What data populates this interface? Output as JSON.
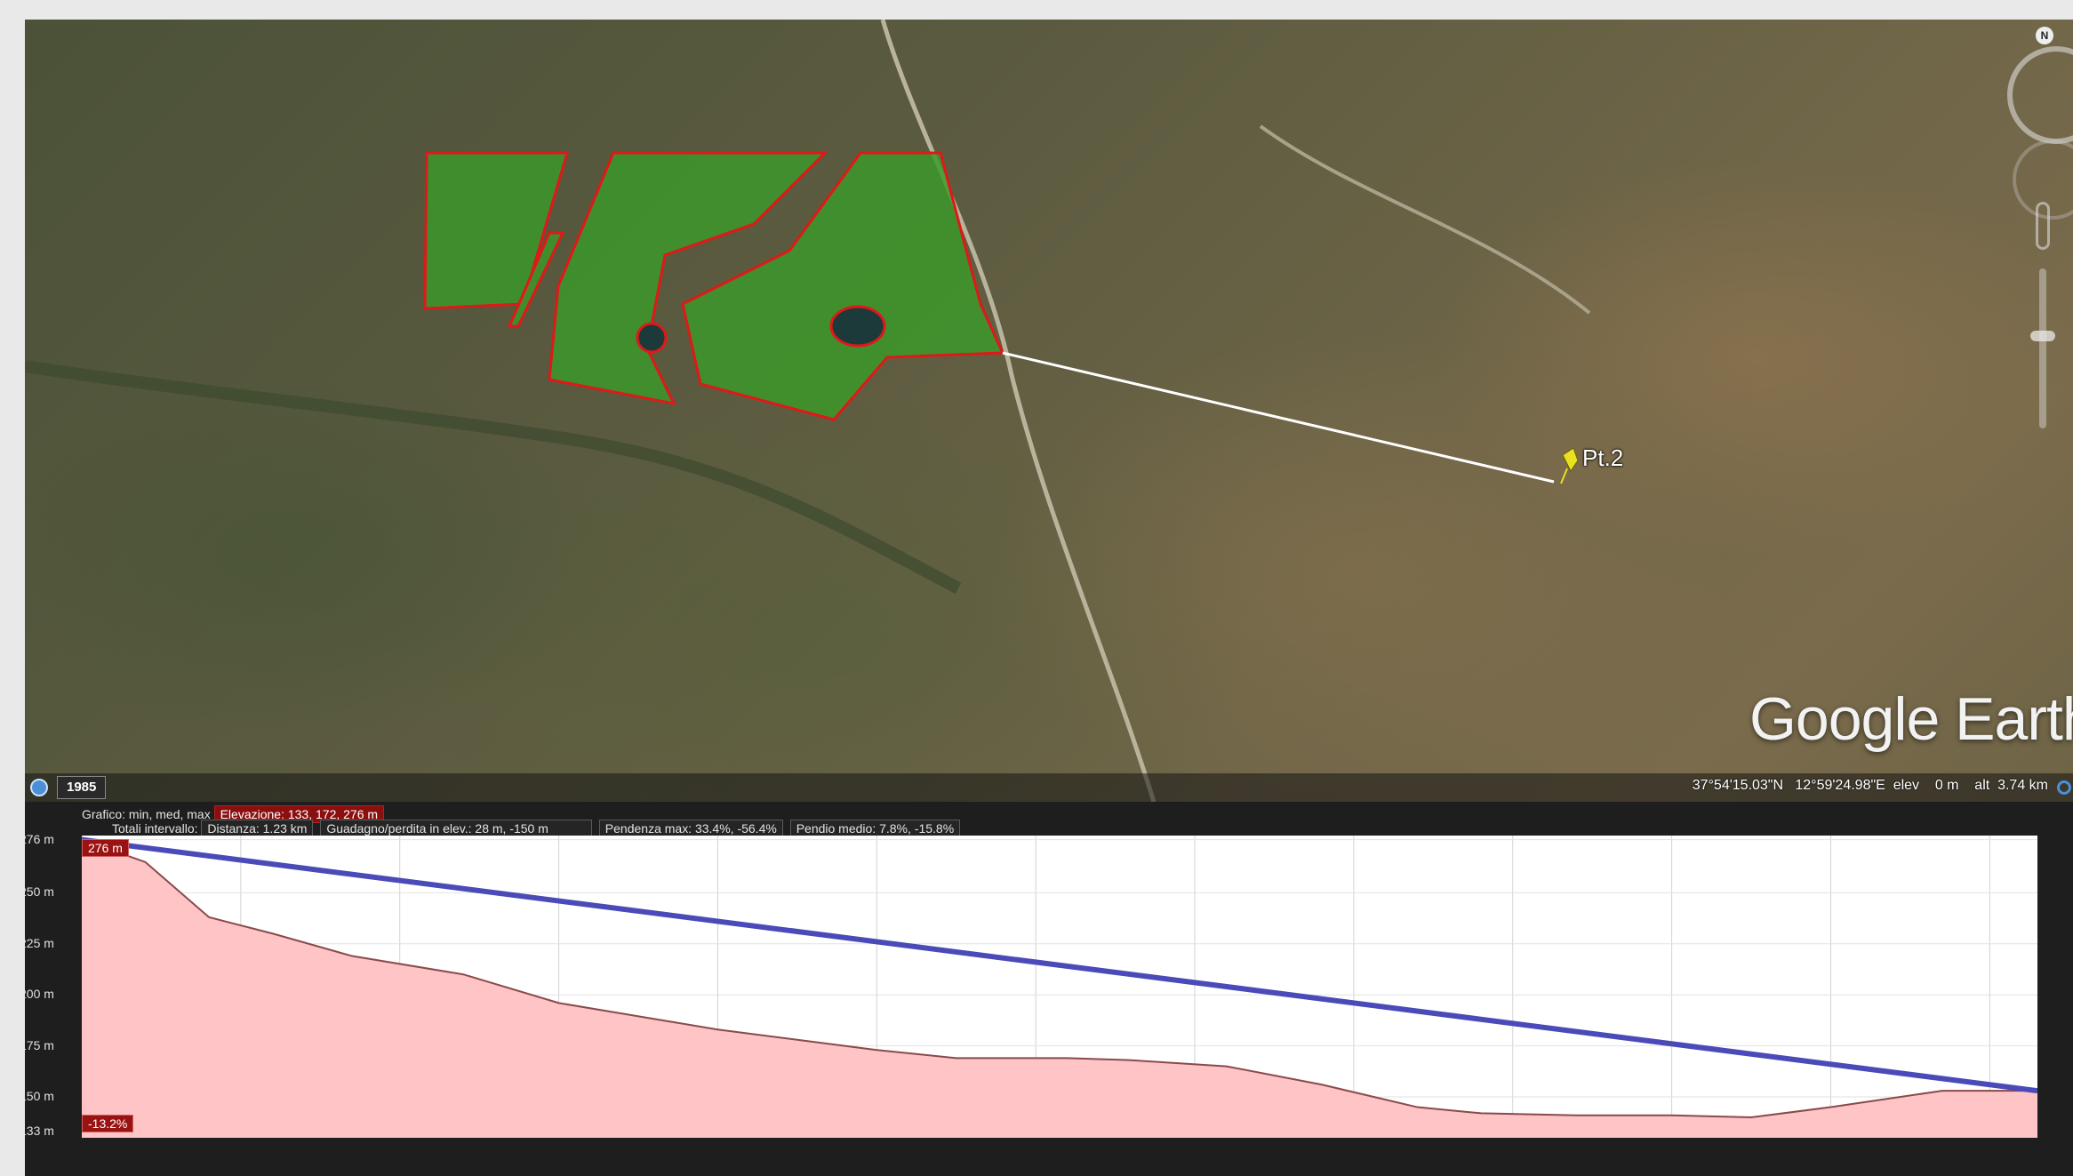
{
  "map": {
    "placemark_label": "Pt.2",
    "placemark_icon": "pushpin-icon",
    "historical_year": "1985",
    "logo_text": "Google Earth",
    "coords_text": "37°54'15.03\"N   12°59'24.98\"E  elev    0 m    alt  3.74 km",
    "north_label": "N",
    "field_color": "#3a9a2a",
    "field_border_color": "#e01818",
    "path_color": "#ffffff"
  },
  "profile": {
    "graph_label": "Grafico: min, med, max",
    "elevation_stats": "Elevazione: 133, 172, 276 m",
    "totals_label": "Totali intervallo:",
    "distance": "Distanza: 1.23 km",
    "gain_loss": "Guadagno/perdita in elev.: 28 m, -150 m",
    "slope_max": "Pendenza max: 33.4%, -56.4%",
    "slope_avg": "Pendio medio: 7.8%, -15.8%",
    "start_marker": "276 m",
    "slope_badge": "-13.2%",
    "fill_color": "#ffc4c6",
    "line_color": "#4a4ab8",
    "profile_line_color": "#8a4a4a"
  },
  "chart_data": {
    "type": "area",
    "ytick_labels": [
      "276 m",
      "250 m",
      "225 m",
      "200 m",
      "175 m",
      "150 m",
      "133 m"
    ],
    "yticks": [
      276,
      250,
      225,
      200,
      175,
      150,
      133
    ],
    "ylim": [
      130,
      278
    ],
    "xlim": [
      0,
      1.23
    ],
    "x_unit": "km",
    "grid": true,
    "series": [
      {
        "x": [
          0,
          0.04,
          0.08,
          0.12,
          0.17,
          0.24,
          0.3,
          0.4,
          0.45,
          0.5,
          0.55,
          0.62,
          0.66,
          0.72,
          0.78,
          0.84,
          0.88,
          0.94,
          1.0,
          1.05,
          1.1,
          1.17,
          1.23
        ],
        "y": [
          276,
          265,
          238,
          230,
          219,
          210,
          196,
          183,
          178,
          173,
          169,
          169,
          168,
          165,
          156,
          145,
          142,
          141,
          141,
          140,
          145,
          153,
          153
        ]
      },
      {
        "x": [
          0,
          1.23
        ],
        "y": [
          276,
          153
        ]
      }
    ]
  }
}
